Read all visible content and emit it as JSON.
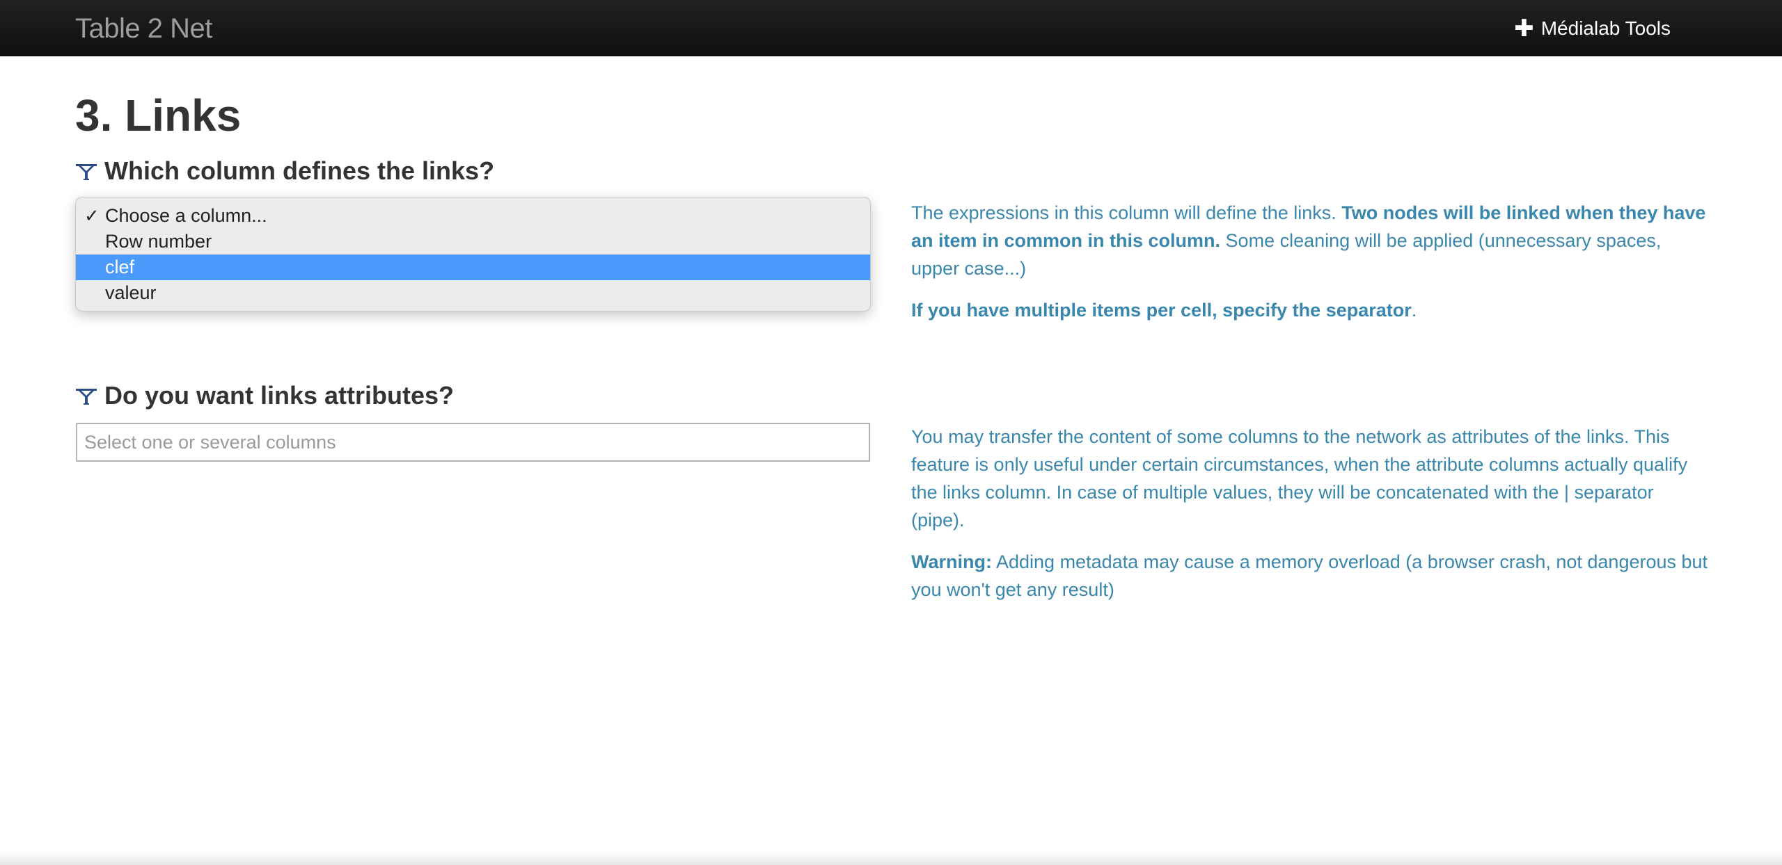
{
  "navbar": {
    "brand": "Table 2 Net",
    "tools_label": "Médialab Tools"
  },
  "page": {
    "title": "3. Links"
  },
  "links_column": {
    "question": "Which column defines the links?",
    "options": [
      "Choose a column...",
      "Row number",
      "clef",
      "valeur"
    ],
    "checked_option": "Choose a column...",
    "highlighted_option": "clef",
    "help": {
      "p1_a": "The expressions in this column will define the links. ",
      "p1_b": "Two nodes will be linked when they have an item in common in this column.",
      "p1_c": " Some cleaning will be applied (unnecessary spaces, upper case...)",
      "p2_a": "If you have multiple items per cell, specify the separator",
      "p2_b": "."
    }
  },
  "links_attributes": {
    "question": "Do you want links attributes?",
    "placeholder": "Select one or several columns",
    "help": {
      "p1": "You may transfer the content of some columns to the network as attributes of the links. This feature is only useful under certain circumstances, when the attribute columns actually qualify the links column. In case of multiple values, they will be concatenated with the | separator (pipe).",
      "p2_a": "Warning:",
      "p2_b": " Adding metadata may cause a memory overload (a browser crash, not dangerous but you won't get any result)"
    }
  },
  "icons": {
    "tools": "plus-icon",
    "question": "medialab-logo-icon",
    "check": "checkmark-icon"
  },
  "colors": {
    "navbar": "#111111",
    "highlight": "#4a99fb",
    "help_text": "#3a87ad"
  }
}
